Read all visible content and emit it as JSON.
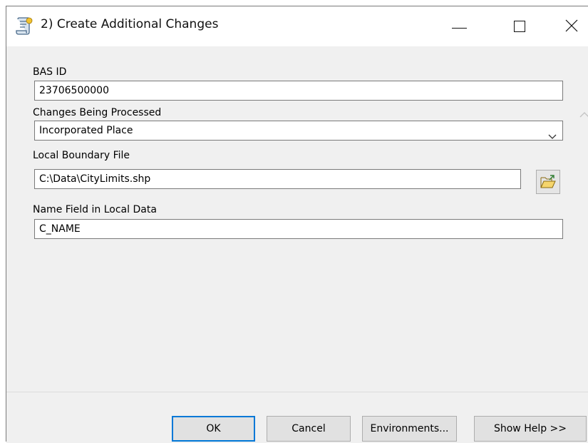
{
  "window": {
    "title": "2) Create Additional Changes",
    "icon": "script-tool-icon",
    "controls": [
      "minimize-icon",
      "maximize-icon",
      "close-icon"
    ]
  },
  "form": {
    "bas_id": {
      "label": "BAS ID",
      "value": "23706500000"
    },
    "changes": {
      "label": "Changes Being Processed",
      "value": "Incorporated Place"
    },
    "boundary_file": {
      "label": "Local Boundary File",
      "value": "C:\\Data\\CityLimits.shp",
      "browse_icon": "folder-open-icon"
    },
    "name_field": {
      "label": "Name Field in Local Data",
      "value": "C_NAME"
    }
  },
  "buttons": {
    "ok": "OK",
    "cancel": "Cancel",
    "environments": "Environments...",
    "show_help": "Show Help >>"
  },
  "colors": {
    "accent": "#0078d7",
    "panel_bg": "#f0f0f0"
  }
}
